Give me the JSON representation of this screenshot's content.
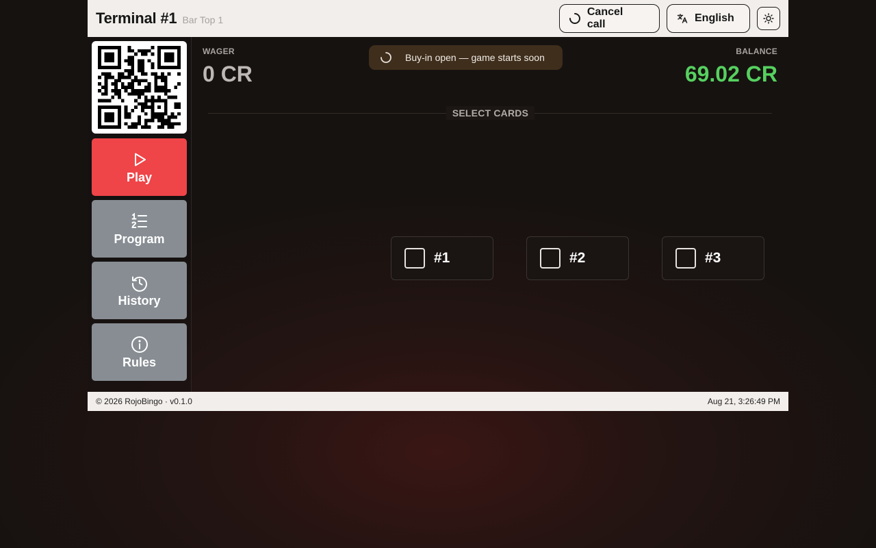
{
  "header": {
    "title": "Terminal #1",
    "subtitle": "Bar Top 1",
    "cancel_call_label": "Cancel call",
    "language_label": "English",
    "icons": {
      "cancel": "spinner-icon",
      "language": "translate-icon",
      "theme": "sun-icon"
    }
  },
  "sidebar": {
    "qr_icon": "qr-code",
    "items": [
      {
        "label": "Play",
        "icon": "play-icon",
        "active": true
      },
      {
        "label": "Program",
        "icon": "numbered-list-icon",
        "active": false
      },
      {
        "label": "History",
        "icon": "history-icon",
        "active": false
      },
      {
        "label": "Rules",
        "icon": "info-icon",
        "active": false
      }
    ]
  },
  "main": {
    "wager_label": "WAGER",
    "wager_value": "0 CR",
    "balance_label": "BALANCE",
    "balance_value": "69.02 CR",
    "status_text": "Buy-in open — game starts soon",
    "section_title": "SELECT CARDS",
    "cards": [
      {
        "label": "#1",
        "checked": false
      },
      {
        "label": "#2",
        "checked": false
      },
      {
        "label": "#3",
        "checked": false
      }
    ]
  },
  "footer": {
    "copyright": "© 2026 RojoBingo · v0.1.0",
    "datetime": "Aug 21, 3:26:49 PM"
  },
  "colors": {
    "accent_red": "#ef4448",
    "nav_gray": "#878d93",
    "balance_green": "#56d05f",
    "status_bg": "#3f2e1c",
    "header_bg": "#f2eeeb"
  }
}
